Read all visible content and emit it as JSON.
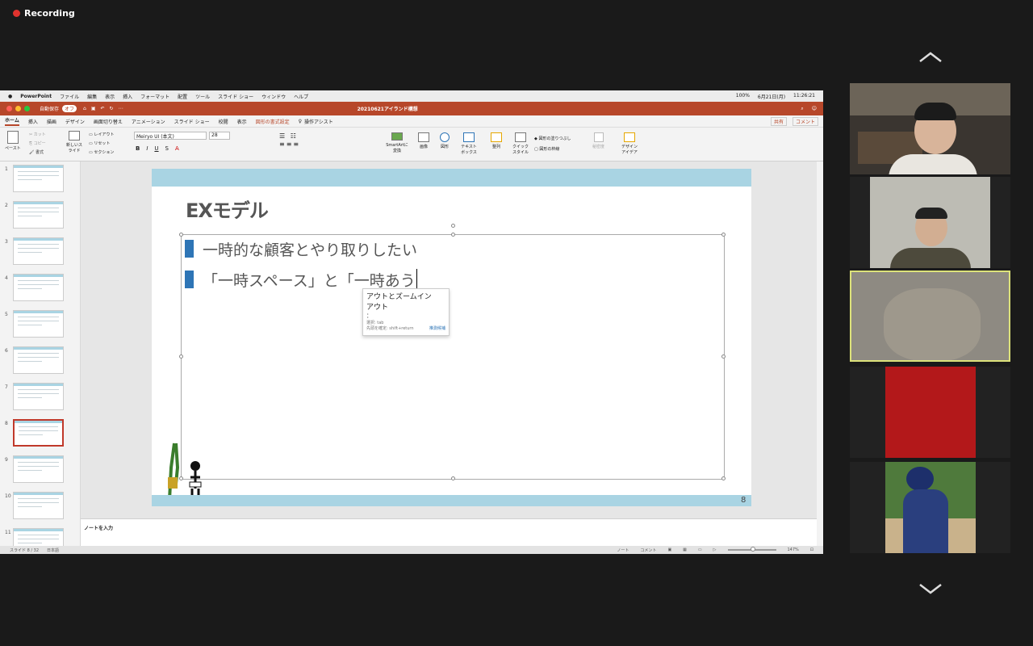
{
  "recording": {
    "label": "Recording",
    "color": "#e0332e"
  },
  "mac_menu": {
    "app": "PowerPoint",
    "items": [
      "ファイル",
      "編集",
      "表示",
      "挿入",
      "フォーマット",
      "配置",
      "ツール",
      "スライド ショー",
      "ウィンドウ",
      "ヘルプ"
    ],
    "battery": "100%",
    "date": "6月21日(月)",
    "time": "11:26:21"
  },
  "title_bar": {
    "autosave": "自動保存",
    "autosave_state": "オフ",
    "doc_title": "20210621アイランド構想",
    "brand_color": "#b7472a"
  },
  "tabs": {
    "items": [
      "ホーム",
      "挿入",
      "描画",
      "デザイン",
      "画面切り替え",
      "アニメーション",
      "スライド ショー",
      "校閲",
      "表示"
    ],
    "contextual": "図形の書式設定",
    "assist": "操作アシスト",
    "share": "共有",
    "comment": "コメント"
  },
  "ribbon": {
    "paste": "ペースト",
    "cut": "カット",
    "copy": "コピー",
    "format": "書式",
    "new_slide": "新しいスライド",
    "layout": "レイアウト",
    "reset": "リセット",
    "section": "セクション",
    "font_name": "Meiryo UI (本文)",
    "font_size": "28",
    "smartart": "SmartArtに変換",
    "image": "画像",
    "shape": "図形",
    "textbox": "テキストボックス",
    "arrange": "整列",
    "quick_style": "クイックスタイル",
    "shape_fill": "図形の塗りつぶし",
    "shape_outline": "図形の枠線",
    "sensitivity": "秘密度",
    "design_ideas": "デザインアイデア"
  },
  "slides": {
    "numbers": [
      "1",
      "2",
      "3",
      "4",
      "5",
      "6",
      "7",
      "8",
      "9",
      "10",
      "11"
    ],
    "selected": "8"
  },
  "slide": {
    "title": "EXモデル",
    "bullet1": "一時的な顧客とやり取りしたい",
    "bullet2": "「一時スペース」と「一時あう",
    "page": "8",
    "accent": "#a9d4e3",
    "bullet_color": "#2e75b6"
  },
  "ime": {
    "candidate1": "アウトとズームイン",
    "candidate2": "アウト",
    "candidate3": "：",
    "hint_select": "選択: tab",
    "hint_confirm": "先頭を確定: shift+return",
    "hint_more": "推測候補"
  },
  "notes": {
    "placeholder": "ノートを入力"
  },
  "status": {
    "slide_count": "スライド 8 / 32",
    "language": "日本語",
    "notes": "ノート",
    "comments": "コメント",
    "zoom": "147%"
  }
}
